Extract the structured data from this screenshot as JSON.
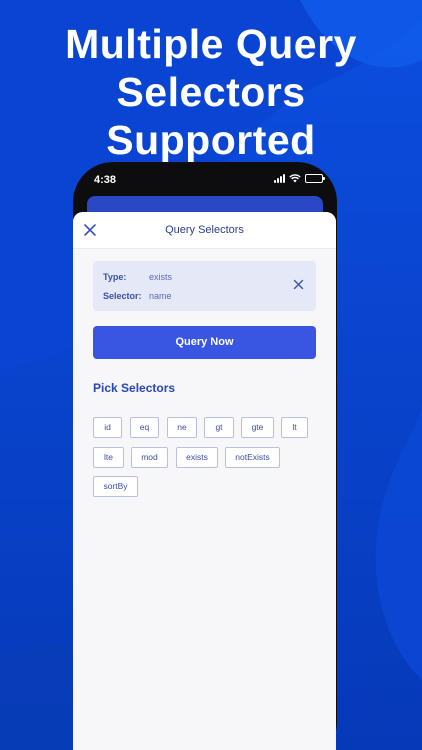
{
  "headline": {
    "line1": "Multiple Query",
    "line2": "Selectors",
    "line3": "Supported"
  },
  "status_bar": {
    "time": "4:38",
    "icons": [
      "signal-icon",
      "wifi-icon",
      "battery-charging-icon"
    ]
  },
  "modal": {
    "title": "Query Selectors",
    "close_icon": "close-icon"
  },
  "selector_card": {
    "type_label": "Type:",
    "type_value": "exists",
    "selector_label": "Selector:",
    "selector_value": "name"
  },
  "query_button": {
    "label": "Query Now"
  },
  "pick_section": {
    "title": "Pick Selectors",
    "chips": [
      "id",
      "eq",
      "ne",
      "gt",
      "gte",
      "lt",
      "lte",
      "mod",
      "exists",
      "notExists",
      "sortBy"
    ]
  },
  "colors": {
    "background": "#0a47d4",
    "accent": "#3956e2",
    "card": "#e4e8f7",
    "sheet": "#f7f7f9"
  }
}
